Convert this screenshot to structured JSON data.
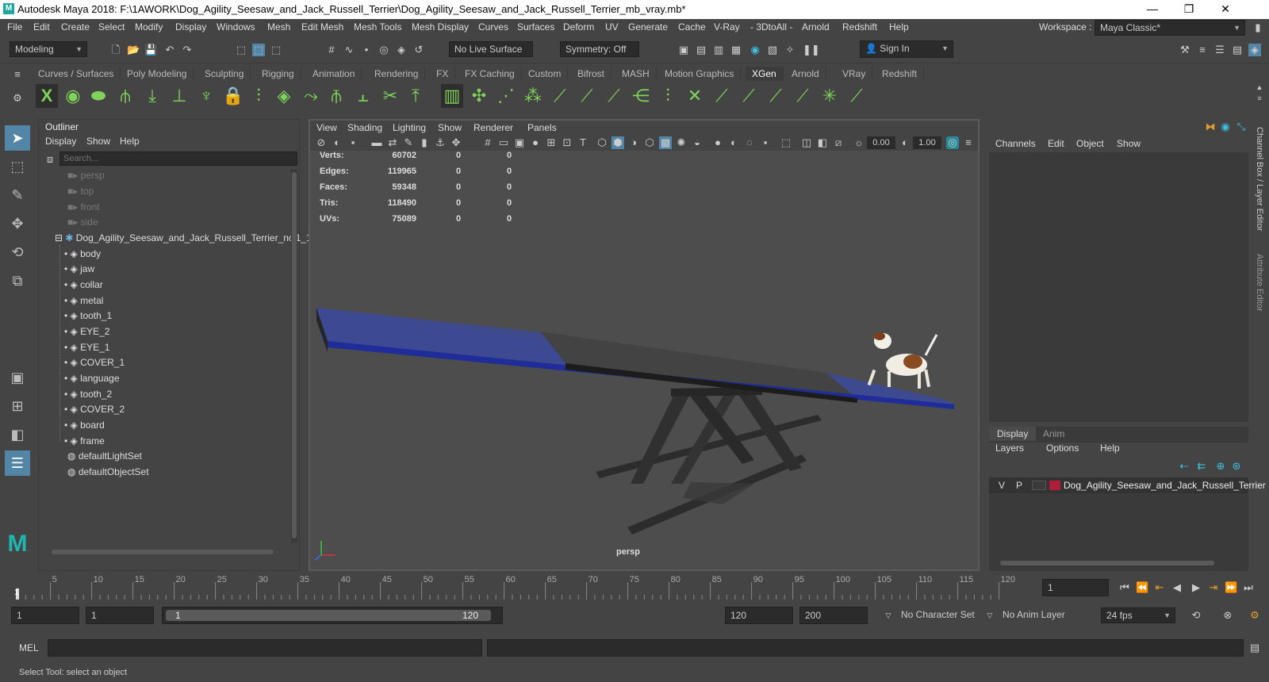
{
  "window": {
    "title": "Autodesk Maya 2018: F:\\1AWORK\\Dog_Agility_Seesaw_and_Jack_Russell_Terrier\\Dog_Agility_Seesaw_and_Jack_Russell_Terrier_mb_vray.mb*",
    "minimize": "—",
    "restore": "❐",
    "close": "✕"
  },
  "menu": [
    "File",
    "Edit",
    "Create",
    "Select",
    "Modify",
    "Display",
    "Windows",
    "Mesh",
    "Edit Mesh",
    "Mesh Tools",
    "Mesh Display",
    "Curves",
    "Surfaces",
    "Deform",
    "UV",
    "Generate",
    "Cache",
    "V-Ray",
    "- 3DtoAll -",
    "Arnold",
    "Redshift",
    "Help"
  ],
  "workspace": {
    "label": "Workspace :",
    "value": "Maya Classic*"
  },
  "status": {
    "mode": "Modeling",
    "live_surface": "No Live Surface",
    "symmetry": "Symmetry: Off",
    "sign_in": "Sign In"
  },
  "shelf_tabs": [
    "Curves / Surfaces",
    "Poly Modeling",
    "Sculpting",
    "Rigging",
    "Animation",
    "Rendering",
    "FX",
    "FX Caching",
    "Custom",
    "Bifrost",
    "MASH",
    "Motion Graphics",
    "XGen",
    "Arnold",
    "VRay",
    "Redshift"
  ],
  "shelf_active": "XGen",
  "outliner": {
    "title": "Outliner",
    "menu": [
      "Display",
      "Show",
      "Help"
    ],
    "search_placeholder": "Search...",
    "cameras": [
      "persp",
      "top",
      "front",
      "side"
    ],
    "root": "Dog_Agility_Seesaw_and_Jack_Russell_Terrier_ncl1_1",
    "children": [
      "body",
      "jaw",
      "collar",
      "metal",
      "tooth_1",
      "EYE_2",
      "EYE_1",
      "COVER_1",
      "language",
      "tooth_2",
      "COVER_2",
      "board",
      "frame"
    ],
    "sets": [
      "defaultLightSet",
      "defaultObjectSet"
    ]
  },
  "viewport": {
    "menu": [
      "View",
      "Shading",
      "Lighting",
      "Show",
      "Renderer",
      "Panels"
    ],
    "exposure": "0.00",
    "gamma": "1.00",
    "camera_label": "persp",
    "hud": [
      {
        "label": "Verts:",
        "v1": "60702",
        "v2": "0",
        "v3": "0"
      },
      {
        "label": "Edges:",
        "v1": "119965",
        "v2": "0",
        "v3": "0"
      },
      {
        "label": "Faces:",
        "v1": "59348",
        "v2": "0",
        "v3": "0"
      },
      {
        "label": "Tris:",
        "v1": "118490",
        "v2": "0",
        "v3": "0"
      },
      {
        "label": "UVs:",
        "v1": "75089",
        "v2": "0",
        "v3": "0"
      }
    ]
  },
  "channel_box": {
    "menu": [
      "Channels",
      "Edit",
      "Object",
      "Show"
    ],
    "side_tab1": "Channel Box / Layer Editor",
    "side_tab2": "Attribute Editor"
  },
  "layer_editor": {
    "tabs": [
      "Display",
      "Anim"
    ],
    "menu": [
      "Layers",
      "Options",
      "Help"
    ],
    "layer": {
      "v": "V",
      "p": "P",
      "name": "Dog_Agility_Seesaw_and_Jack_Russell_Terrier",
      "color": "#b01d3a"
    }
  },
  "timeline": {
    "ticks": [
      "5",
      "10",
      "15",
      "20",
      "25",
      "30",
      "35",
      "40",
      "45",
      "50",
      "55",
      "60",
      "65",
      "70",
      "75",
      "80",
      "85",
      "90",
      "95",
      "100",
      "105",
      "110",
      "115",
      "120"
    ],
    "current_frame": "1",
    "playhead_label": "1"
  },
  "range": {
    "start": "1",
    "inner_start": "1",
    "slider_start": "1",
    "slider_end": "120",
    "end": "120",
    "outer_end": "200",
    "character_set": "No Character Set",
    "anim_layer": "No Anim Layer",
    "fps": "24 fps"
  },
  "mel": {
    "label": "MEL"
  },
  "help_line": "Select Tool: select an object",
  "colors": {
    "accent": "#5285a6",
    "xgen_green": "#7fd35a",
    "seesaw_blue": "#2f3a8c"
  }
}
